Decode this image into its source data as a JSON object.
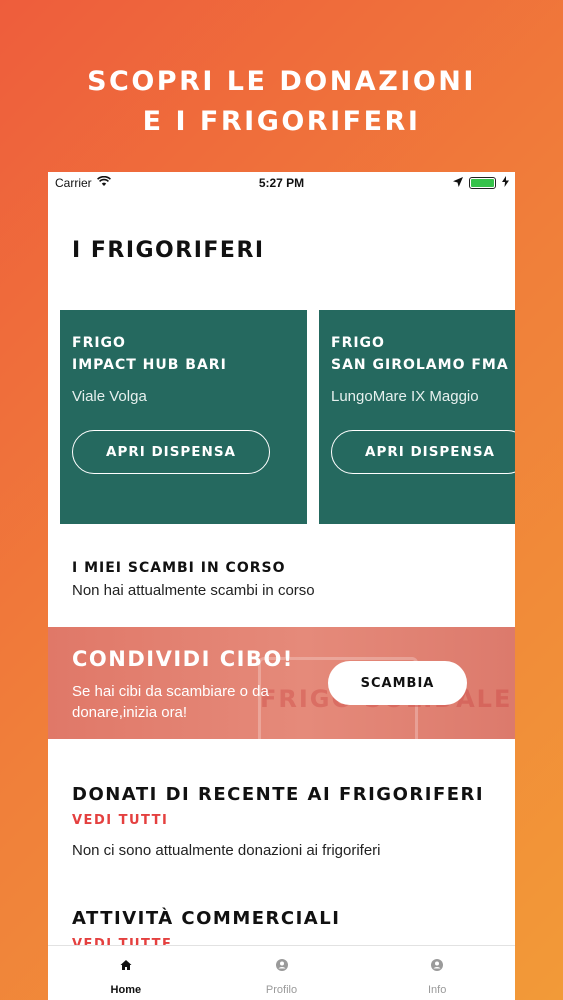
{
  "promo": {
    "line1": "SCOPRI LE DONAZIONI",
    "line2": "E I FRIGORIFERI"
  },
  "status_bar": {
    "carrier": "Carrier",
    "time": "5:27 PM"
  },
  "fridges": {
    "title": "I FRIGORIFERI",
    "cards": [
      {
        "line1": "FRIGO",
        "line2": "IMPACT HUB BARI",
        "address": "Viale Volga",
        "button": "APRI DISPENSA"
      },
      {
        "line1": "FRIGO",
        "line2": "SAN GIROLAMO FMA",
        "address": "LungoMare IX Maggio",
        "button": "APRI DISPENSA"
      }
    ]
  },
  "exchanges": {
    "title": "I MIEI SCAMBI IN CORSO",
    "text": "Non hai attualmente scambi in corso"
  },
  "share_banner": {
    "title": "CONDIVIDI CIBO!",
    "text": "Se hai cibi da scambiare o da donare,inizia ora!",
    "button": "SCAMBIA",
    "background_text": "FRIGO SOLIDALE"
  },
  "recent": {
    "title": "DONATI DI RECENTE AI FRIGORIFERI",
    "link": "VEDI TUTTI",
    "text": "Non ci sono attualmente donazioni ai frigoriferi"
  },
  "commercial": {
    "title": "ATTIVITÀ COMMERCIALI",
    "link": "VEDI TUTTE"
  },
  "tabbar": {
    "items": [
      {
        "label": "Home",
        "icon": "home-icon",
        "active": true
      },
      {
        "label": "Profilo",
        "icon": "profile-icon",
        "active": false
      },
      {
        "label": "Info",
        "icon": "info-icon",
        "active": false
      }
    ]
  },
  "colors": {
    "accent": "#e4403f",
    "card_green": "#25695f",
    "gradient_start": "#ee5d3c",
    "gradient_end": "#f29a38"
  }
}
